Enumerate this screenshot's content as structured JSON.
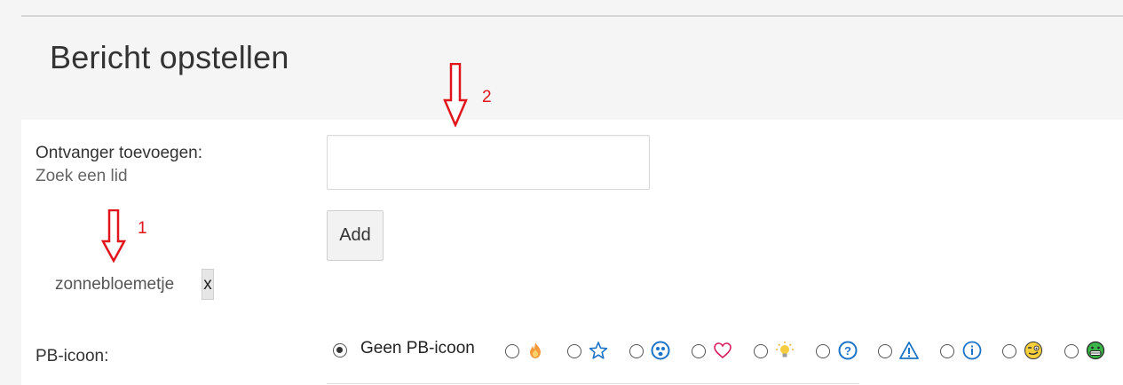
{
  "page": {
    "title": "Bericht opstellen"
  },
  "recipient": {
    "label": "Ontvanger toevoegen:",
    "hint": "Zoek een lid",
    "value": "",
    "add_label": "Add",
    "selected": {
      "name": "zonnebloemetje",
      "remove_label": "x"
    }
  },
  "annotations": {
    "first": "1",
    "second": "2",
    "color": "#e0151b"
  },
  "pb_icon": {
    "label": "PB-icoon:",
    "none_label": "Geen PB-icoon",
    "selected": "none",
    "options": [
      "fire-icon",
      "star-icon",
      "worried-face-icon",
      "heart-icon",
      "lightbulb-icon",
      "question-icon",
      "warning-icon",
      "info-icon",
      "wink-face-icon",
      "grin-face-icon"
    ]
  }
}
